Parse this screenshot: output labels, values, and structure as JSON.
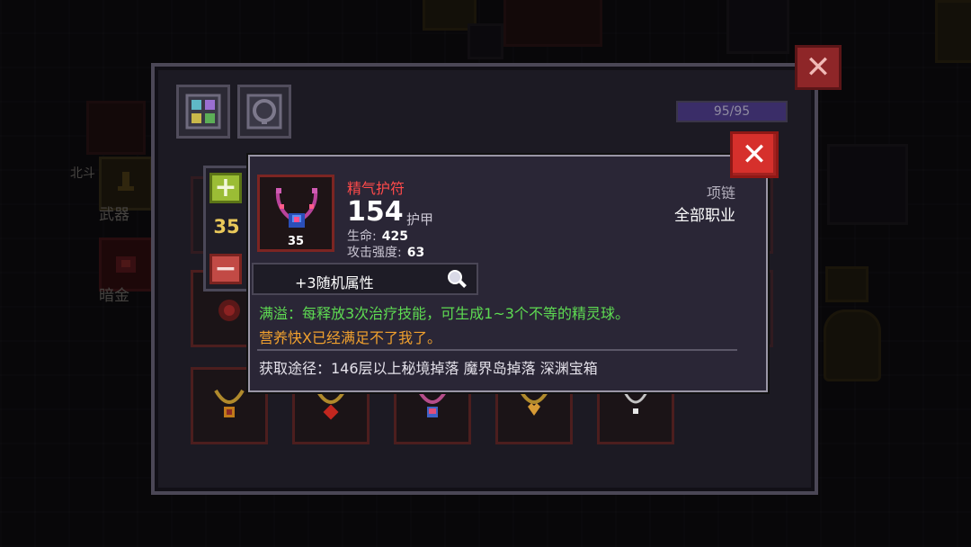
{
  "background": {
    "labels": [
      "北斗",
      "武器",
      "暗金"
    ]
  },
  "panel": {
    "hp_text": "95/95",
    "hp_fraction": 1.0,
    "close_icon": "close-icon",
    "tabs": [
      "inventory-tab-icon",
      "necklace-tab-icon"
    ]
  },
  "stepper": {
    "level": "35",
    "plus_icon": "plus-icon",
    "minus_icon": "minus-icon"
  },
  "item": {
    "name": "精气护符",
    "level_badge": "35",
    "armor_value": "154",
    "armor_label": "护甲",
    "stats": [
      {
        "label": "生命:",
        "value": "425"
      },
      {
        "label": "攻击强度:",
        "value": "63"
      }
    ],
    "type": "项链",
    "class": "全部职业",
    "random_attr": "+3随机属性",
    "desc_green": "满溢：每释放3次治疗技能，可生成1~3个不等的精灵球。",
    "desc_orange": "营养快X已经满足不了我了。",
    "source": "获取途径：146层以上秘境掉落 魔界岛掉落 深渊宝箱",
    "colors": {
      "name": "#ff4a4a",
      "desc_green": "#5edb52",
      "desc_orange": "#f1a12e",
      "close": "#d6302c"
    }
  }
}
